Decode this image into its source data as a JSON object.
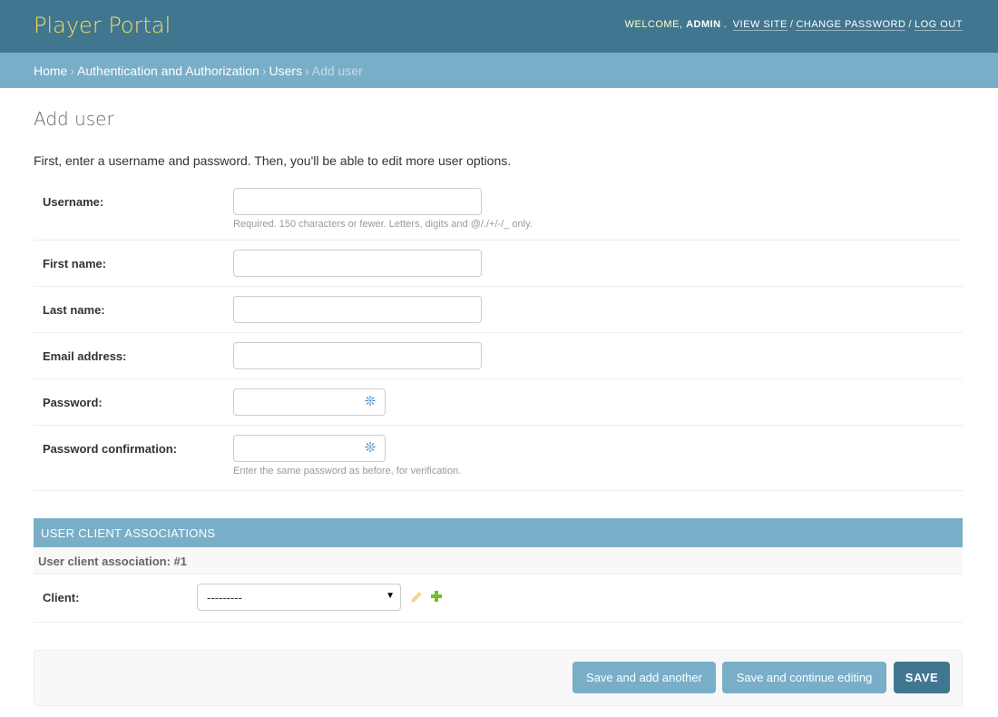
{
  "header": {
    "brand": "Player Portal",
    "welcome": "WELCOME,",
    "user": "ADMIN",
    "view_site": "VIEW SITE",
    "change_password": "CHANGE PASSWORD",
    "log_out": "LOG OUT"
  },
  "breadcrumbs": {
    "home": "Home",
    "app": "Authentication and Authorization",
    "model": "Users",
    "current": "Add user"
  },
  "page": {
    "title": "Add user",
    "intro": "First, enter a username and password. Then, you'll be able to edit more user options."
  },
  "fields": {
    "username": {
      "label": "Username:",
      "value": "",
      "help": "Required. 150 characters or fewer. Letters, digits and @/./+/-/_ only."
    },
    "first_name": {
      "label": "First name:",
      "value": ""
    },
    "last_name": {
      "label": "Last name:",
      "value": ""
    },
    "email": {
      "label": "Email address:",
      "value": ""
    },
    "password": {
      "label": "Password:",
      "value": ""
    },
    "password_confirmation": {
      "label": "Password confirmation:",
      "value": "",
      "help": "Enter the same password as before, for verification."
    }
  },
  "inline": {
    "title": "USER CLIENT ASSOCIATIONS",
    "subtitle": "User client association: #1",
    "client_label": "Client:",
    "client_value": "---------"
  },
  "actions": {
    "save_add_another": "Save and add another",
    "save_continue": "Save and continue editing",
    "save": "SAVE"
  },
  "icons": {
    "password_toggle": "sparkle-icon",
    "edit": "pencil-icon",
    "add": "plus-icon",
    "dropdown": "caret-down-icon"
  },
  "colors": {
    "header_bg": "#417690",
    "breadcrumb_bg": "#79aec8",
    "brand_text": "#f5dd5d",
    "primary_button": "#417690",
    "secondary_button": "#79aec8"
  }
}
